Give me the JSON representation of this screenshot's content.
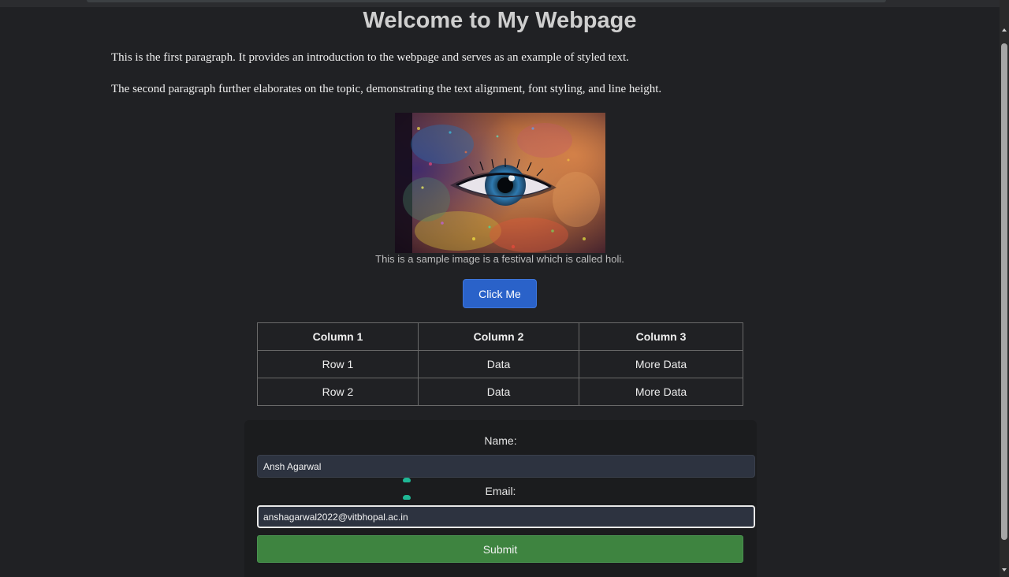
{
  "page": {
    "heading": "Welcome to My Webpage",
    "paragraph_1": "This is the first paragraph. It provides an introduction to the webpage and serves as an example of styled text.",
    "paragraph_2": "The second paragraph further elaborates on the topic, demonstrating the text alignment, font styling, and line height."
  },
  "image": {
    "caption": "This is a sample image is a festival which is called holi."
  },
  "button": {
    "label": "Click Me"
  },
  "table": {
    "headers": [
      "Column 1",
      "Column 2",
      "Column 3"
    ],
    "rows": [
      [
        "Row 1",
        "Data",
        "More Data"
      ],
      [
        "Row 2",
        "Data",
        "More Data"
      ]
    ]
  },
  "form": {
    "name_label": "Name:",
    "name_value": "Ansh Agarwal",
    "email_label": "Email:",
    "email_value": "anshagarwal2022@vitbhopal.ac.in",
    "submit_label": "Submit"
  },
  "icons": {
    "password_manager": "password-manager-icon"
  },
  "colors": {
    "background": "#202124",
    "button_primary": "#2a62c9",
    "submit_green": "#3e8440",
    "input_bg": "#2d3340"
  }
}
